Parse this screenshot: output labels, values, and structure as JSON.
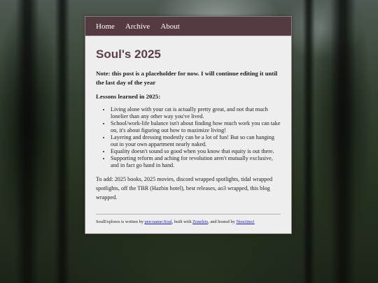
{
  "nav": {
    "items": [
      "Home",
      "Archive",
      "About"
    ]
  },
  "post": {
    "title": "Soul's 2025",
    "note": "Note: this post is a placeholder for now. I will continue editing it until the last day of the year",
    "lessons_heading": "Lessons learned in 2025:",
    "lessons": [
      "Living alone with your cat is actually pretty great, and not that much lonelier than any other way you've lived.",
      "School/work-life balance isn't about finding how much work you can take on, it's about figuring out how to mazimize living!",
      "Layering and dressing modestly can be a lot of fun! But so can hanging out in your own appartment nearly naked.",
      "Equality doesn't sound so good when you know that equity is out there.",
      "Supporting reform and aching for revolution aren't mutually exclusive, and in fact go hand in hand."
    ],
    "todo": "To add: 2025 books, 2025 movies, discord wrapped spotlights, tidal wrapped spotlights, off the TBR (Hazbin hotel), best releases, ao3 wrapped, this blog wrapped."
  },
  "footer": {
    "text_1": "SoulExplores is written by ",
    "link_author": "pen-name-Soul",
    "text_2": ", built with ",
    "link_builder": "Zonelets",
    "text_3": ", and hosted by ",
    "link_host": "Neocities!"
  }
}
